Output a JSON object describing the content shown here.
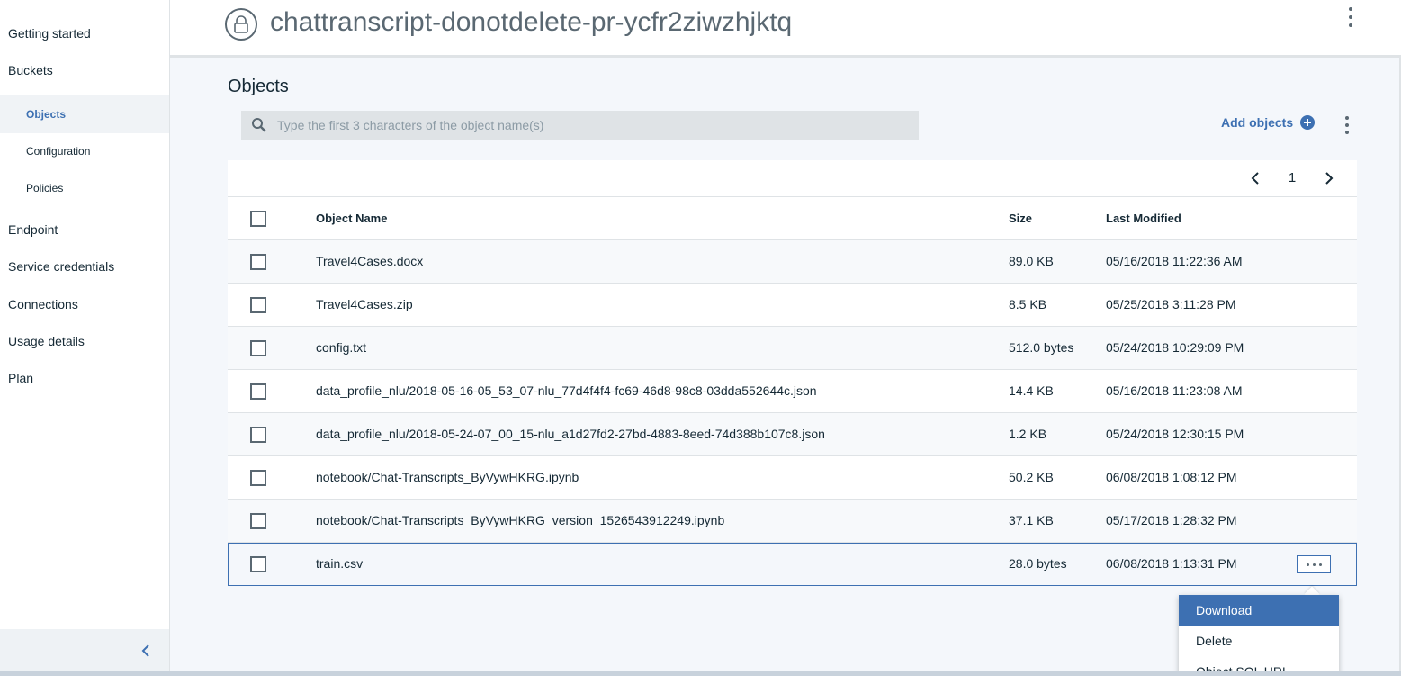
{
  "sidebar": {
    "items": [
      {
        "label": "Getting started"
      },
      {
        "label": "Buckets"
      },
      {
        "label": "Objects"
      },
      {
        "label": "Configuration"
      },
      {
        "label": "Policies"
      },
      {
        "label": "Endpoint"
      },
      {
        "label": "Service credentials"
      },
      {
        "label": "Connections"
      },
      {
        "label": "Usage details"
      },
      {
        "label": "Plan"
      }
    ],
    "active_item": "Objects",
    "collapse_icon": "chevron-left-icon"
  },
  "header": {
    "bucket_name": "chattranscript-donotdelete-pr-ycfr2ziwzhjktq",
    "bucket_icon": "lock-icon"
  },
  "main": {
    "title": "Objects",
    "search": {
      "placeholder": "Type the first 3 characters of the object name(s)",
      "value": ""
    },
    "add_objects_label": "Add objects"
  },
  "table": {
    "page": "1",
    "columns": {
      "name": "Object Name",
      "size": "Size",
      "modified": "Last Modified"
    },
    "rows": [
      {
        "name": "Travel4Cases.docx",
        "size": "89.0 KB",
        "modified": "05/16/2018 11:22:36 AM"
      },
      {
        "name": "Travel4Cases.zip",
        "size": "8.5 KB",
        "modified": "05/25/2018 3:11:28 PM"
      },
      {
        "name": "config.txt",
        "size": "512.0 bytes",
        "modified": "05/24/2018 10:29:09 PM"
      },
      {
        "name": "data_profile_nlu/2018-05-16-05_53_07-nlu_77d4f4f4-fc69-46d8-98c8-03dda552644c.json",
        "size": "14.4 KB",
        "modified": "05/16/2018 11:23:08 AM"
      },
      {
        "name": "data_profile_nlu/2018-05-24-07_00_15-nlu_a1d27fd2-27bd-4883-8eed-74d388b107c8.json",
        "size": "1.2 KB",
        "modified": "05/24/2018 12:30:15 PM"
      },
      {
        "name": "notebook/Chat-Transcripts_ByVywHKRG.ipynb",
        "size": "50.2 KB",
        "modified": "06/08/2018 1:08:12 PM"
      },
      {
        "name": "notebook/Chat-Transcripts_ByVywHKRG_version_1526543912249.ipynb",
        "size": "37.1 KB",
        "modified": "05/17/2018 1:28:32 PM"
      },
      {
        "name": "train.csv",
        "size": "28.0 bytes",
        "modified": "06/08/2018 1:13:31 PM"
      }
    ]
  },
  "context_menu": {
    "items": [
      {
        "label": "Download"
      },
      {
        "label": "Delete"
      },
      {
        "label": "Object SQL URL"
      }
    ],
    "highlighted": "Download"
  },
  "colors": {
    "accent": "#3d70b2",
    "text": "#152935",
    "muted": "#5a6872",
    "background": "#f4f7fb"
  }
}
